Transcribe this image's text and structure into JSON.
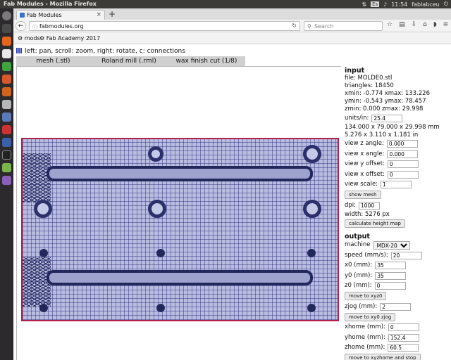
{
  "topbar": {
    "title": "Fab Modules - Mozilla Firefox",
    "keyboard": "Es",
    "clock": "11:54",
    "user": "fablabceu"
  },
  "browser": {
    "tab_title": "Fab Modules",
    "url": "fabmodules.org",
    "search_placeholder": "Search",
    "bookmarks": [
      "mods",
      "Fab Academy 2017"
    ]
  },
  "page": {
    "help": "left: pan, scroll: zoom, right: rotate, c: connections",
    "modules": [
      "mesh (.stl)",
      "Roland mill (.rml)",
      "wax finish cut (1/8)"
    ]
  },
  "input": {
    "heading": "input",
    "file": "file: MOLDE0.stl",
    "triangles": "triangles: 18450",
    "xrange": "xmin: -0.774 xmax: 133.226",
    "yrange": "ymin: -0.543 ymax: 78.457",
    "zrange": "zmin: 0.000 zmax: 29.998",
    "units_label": "units/in:",
    "units_value": "25.4",
    "size_mm": "134.000 x 79.000 x 29.998 mm",
    "size_in": "5.276 x 3.110 x 1.181 in",
    "view_z_label": "view z angle:",
    "view_z_value": "0.000",
    "view_x_label": "view x angle:",
    "view_x_value": "0.000",
    "view_y_off_label": "view y offset:",
    "view_y_off_value": "0",
    "view_x_off_label": "view x offset:",
    "view_x_off_value": "0",
    "view_scale_label": "view scale:",
    "view_scale_value": "1",
    "show_mesh": "show mesh",
    "dpi_label": "dpi:",
    "dpi_value": "1000",
    "width": "width: 5276 px",
    "calc_height": "calculate height map"
  },
  "output": {
    "heading": "output",
    "machine_label": "machine",
    "machine_value": "MDX-20",
    "speed_label": "speed (mm/s):",
    "speed_value": "20",
    "x0_label": "x0 (mm):",
    "x0_value": "35",
    "y0_label": "y0 (mm):",
    "y0_value": "35",
    "z0_label": "z0 (mm):",
    "z0_value": "0",
    "move_xyz0": "move to xyz0",
    "zjog_label": "zjog (mm):",
    "zjog_value": "2",
    "move_xy0": "move to xy0 zjog",
    "xhome_label": "xhome (mm):",
    "xhome_value": "0",
    "yhome_label": "yhome (mm):",
    "yhome_value": "152.4",
    "zhome_label": "zhome (mm):",
    "zhome_value": "60.5",
    "move_home": "move to xyzhome and stop"
  }
}
